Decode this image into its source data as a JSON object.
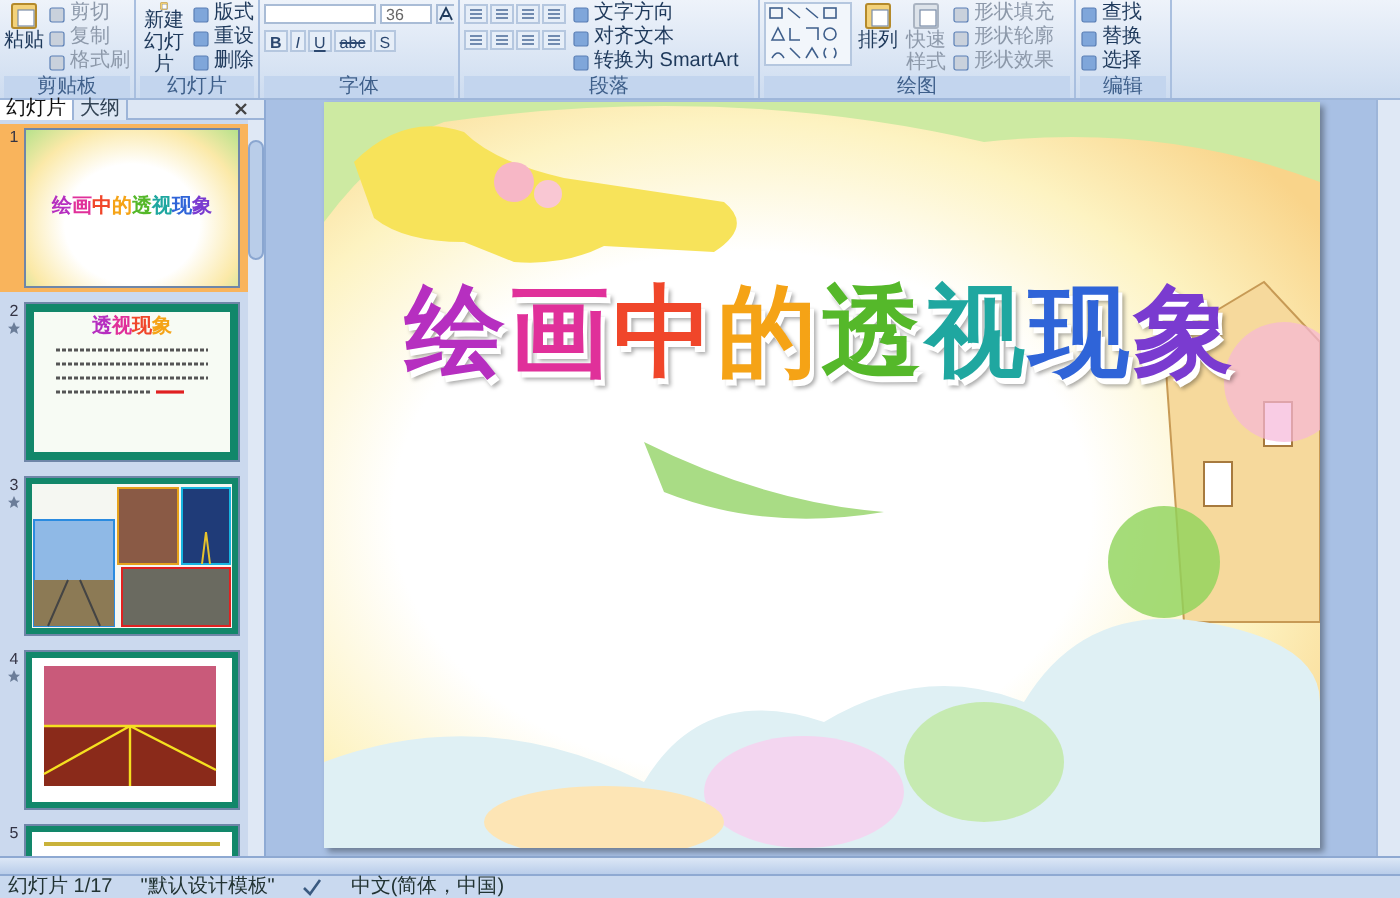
{
  "ribbon": {
    "groups": [
      {
        "kind": "clipboard",
        "label": "剪贴板",
        "large": {
          "label": "粘贴",
          "disabled": false
        },
        "buttons": [
          {
            "label": "剪切",
            "disabled": true
          },
          {
            "label": "复制",
            "disabled": true
          },
          {
            "label": "格式刷",
            "disabled": true
          }
        ]
      },
      {
        "kind": "slides",
        "label": "幻灯片",
        "large": {
          "label": "新建幻灯片",
          "disabled": false
        },
        "buttons": [
          {
            "label": "版式",
            "disabled": false
          },
          {
            "label": "重设",
            "disabled": false
          },
          {
            "label": "删除",
            "disabled": false
          }
        ]
      },
      {
        "kind": "font",
        "label": "字体",
        "font_size": "36",
        "format_buttons": [
          "B",
          "I",
          "U",
          "abc",
          "S"
        ]
      },
      {
        "kind": "paragraph",
        "label": "段落",
        "buttons": [
          {
            "label": "文字方向",
            "disabled": false
          },
          {
            "label": "对齐文本",
            "disabled": false
          },
          {
            "label": "转换为 SmartArt",
            "disabled": false
          }
        ]
      },
      {
        "kind": "drawing",
        "label": "绘图",
        "large_buttons": [
          {
            "label": "排列",
            "disabled": false
          },
          {
            "label": "快速样式",
            "disabled": true
          }
        ],
        "buttons": [
          {
            "label": "形状填充",
            "disabled": true
          },
          {
            "label": "形状轮廓",
            "disabled": true
          },
          {
            "label": "形状效果",
            "disabled": true
          }
        ]
      },
      {
        "kind": "editing",
        "label": "编辑",
        "buttons": [
          {
            "label": "查找",
            "disabled": false
          },
          {
            "label": "替换",
            "disabled": false
          },
          {
            "label": "选择",
            "disabled": false
          }
        ]
      }
    ]
  },
  "panel_tabs": [
    {
      "label": "幻灯片",
      "selected": true
    },
    {
      "label": "大纲",
      "selected": false
    }
  ],
  "thumbnails": [
    {
      "number": "1",
      "selected": true,
      "animated": false,
      "kind": "title",
      "title": "绘画中的透视现象"
    },
    {
      "number": "2",
      "selected": false,
      "animated": true,
      "kind": "text",
      "title": "透视现象"
    },
    {
      "number": "3",
      "selected": false,
      "animated": true,
      "kind": "photos"
    },
    {
      "number": "4",
      "selected": false,
      "animated": true,
      "kind": "road"
    },
    {
      "number": "5",
      "selected": false,
      "animated": false,
      "kind": "shapes"
    }
  ],
  "slide": {
    "title": "绘画中的透视现象"
  },
  "status_bar": {
    "slide_position": "幻灯片 1/17",
    "theme": "\"默认设计模板\"",
    "language": "中文(简体，中国)"
  }
}
